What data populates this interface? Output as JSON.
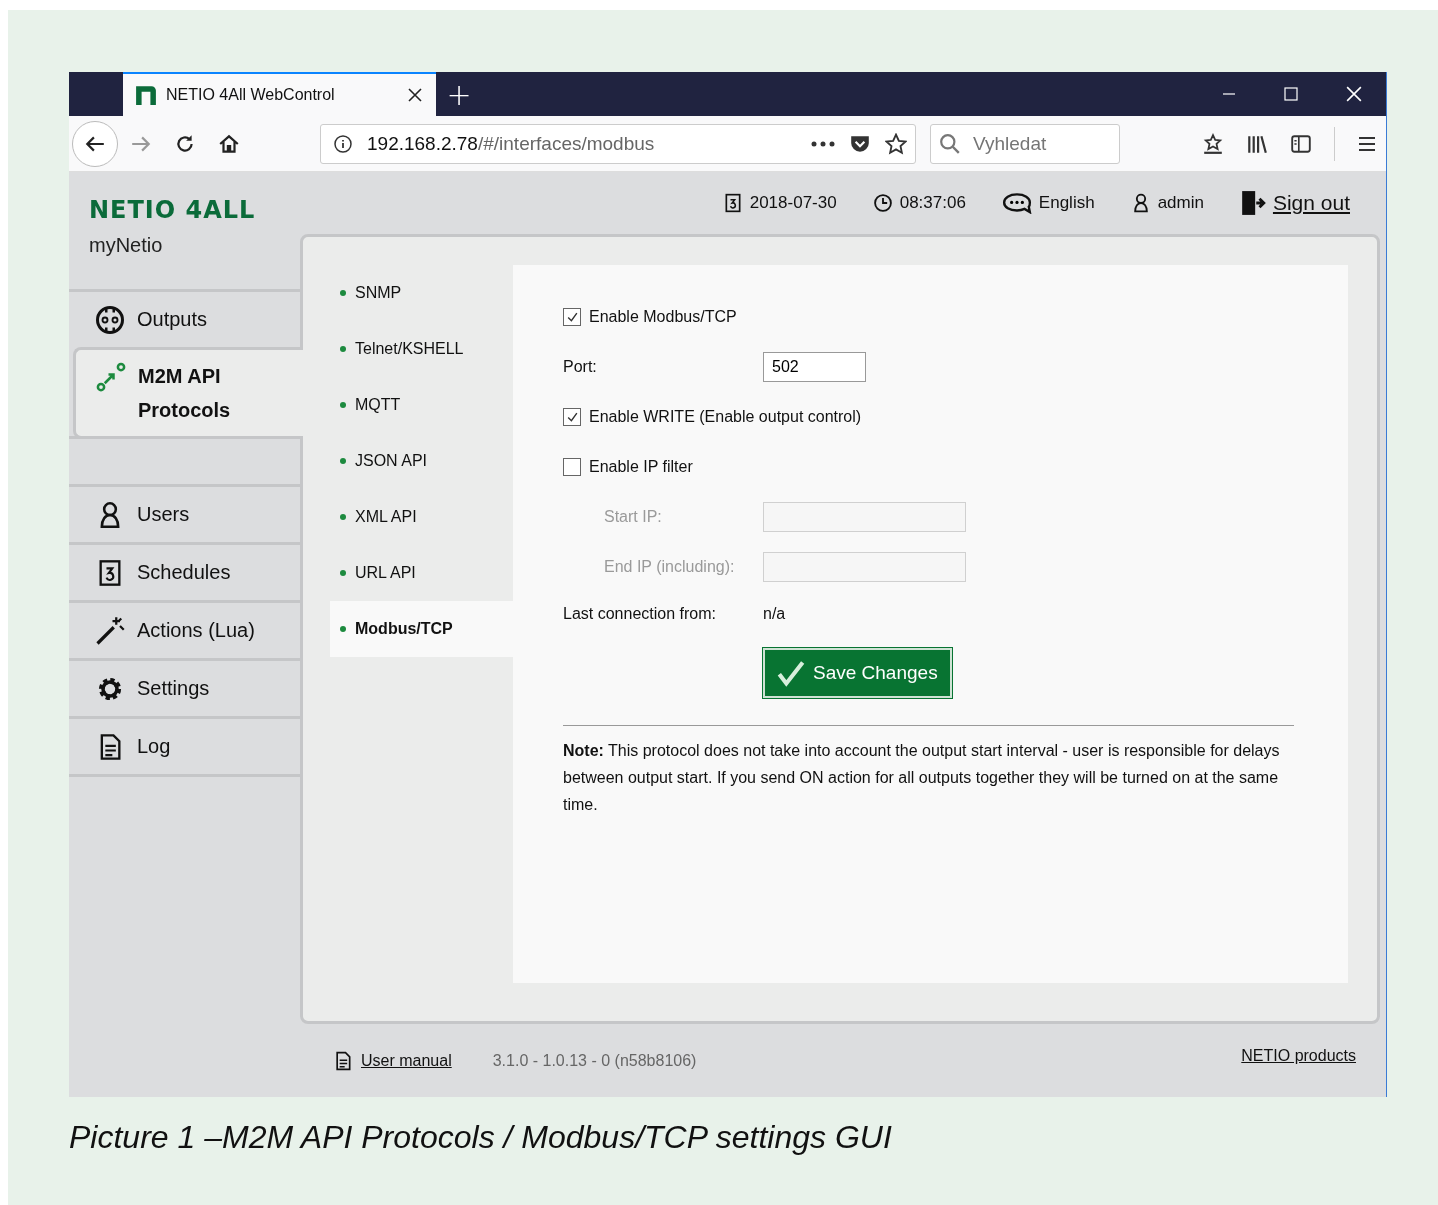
{
  "browser": {
    "tab_title": "NETIO 4All WebControl",
    "new_tab": "+",
    "url_host": "192.168.2.78",
    "url_path": "/#/interfaces/modbus",
    "search_placeholder": "Vyhledat"
  },
  "app": {
    "logo": "NETIO 4ALL",
    "subtitle": "myNetio"
  },
  "header": {
    "date": "2018-07-30",
    "time": "08:37:06",
    "language": "English",
    "user": "admin",
    "sign_out": "Sign out"
  },
  "nav_groups": [
    {
      "items": [
        {
          "label": "Outputs",
          "selected": false
        },
        {
          "label": "M2M API Protocols",
          "selected": true
        }
      ]
    },
    {
      "items": [
        {
          "label": "Users",
          "selected": false
        },
        {
          "label": "Schedules",
          "selected": false
        },
        {
          "label": "Actions (Lua)",
          "selected": false
        },
        {
          "label": "Settings",
          "selected": false
        },
        {
          "label": "Log",
          "selected": false
        }
      ]
    }
  ],
  "submenu": [
    {
      "label": "SNMP",
      "selected": false
    },
    {
      "label": "Telnet/KSHELL",
      "selected": false
    },
    {
      "label": "MQTT",
      "selected": false
    },
    {
      "label": "JSON API",
      "selected": false
    },
    {
      "label": "XML API",
      "selected": false
    },
    {
      "label": "URL API",
      "selected": false
    },
    {
      "label": "Modbus/TCP",
      "selected": true
    }
  ],
  "form": {
    "enable_modbus": {
      "label": "Enable Modbus/TCP",
      "checked": true
    },
    "port": {
      "label": "Port:",
      "value": "502"
    },
    "enable_write": {
      "label": "Enable WRITE (Enable output control)",
      "checked": true
    },
    "enable_ip_filter": {
      "label": "Enable IP filter",
      "checked": false
    },
    "start_ip": {
      "label": "Start IP:",
      "disabled": true
    },
    "end_ip": {
      "label": "End IP (including):",
      "disabled": true
    },
    "last_connection": {
      "label": "Last connection from:",
      "value": "n/a"
    },
    "save_button": "Save Changes",
    "note": "**Note:** This protocol does not take into account the output start interval - user is responsible for delays between output start. If you send ON action for all outputs together they will be turned on at the same time."
  },
  "footer": {
    "user_manual": "User manual",
    "version": "3.1.0 - 1.0.13 - 0 (n58b8106)",
    "products": "NETIO products"
  },
  "caption": "Picture 1 –M2M API Protocols / Modbus/TCP settings GUI"
}
